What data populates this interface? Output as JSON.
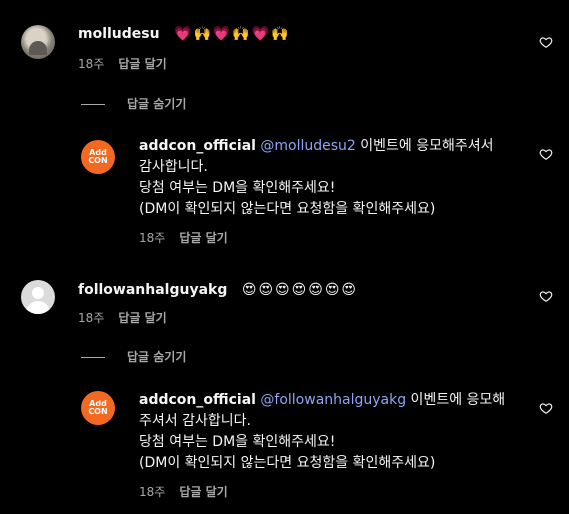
{
  "comments": [
    {
      "username": "molludesu",
      "emojis": "💗🙌💗🙌💗🙌",
      "time": "18주",
      "reply_label": "답글 달기",
      "hide_label": "답글 숨기기",
      "reply": {
        "username": "addcon_official",
        "mention": "@molludesu2",
        "text_line1_rest": " 이벤트에 응모해주셔서",
        "text_line2": "감사합니다.",
        "text_line3": "당첨 여부는 DM을 확인해주세요!",
        "text_line4": "(DM이 확인되지 않는다면 요청함을 확인해주세요)",
        "time": "18주",
        "reply_label": "답글 달기"
      }
    },
    {
      "username": "followanhalguyakg",
      "emojis": "😍😍😍😍😍😍😍",
      "time": "18주",
      "reply_label": "답글 달기",
      "hide_label": "답글 숨기기",
      "reply": {
        "username": "addcon_official",
        "mention": "@followanhalguyakg",
        "text_line1_rest": " 이벤트에 응모해",
        "text_line2": "주셔서 감사합니다.",
        "text_line3": "당첨 여부는 DM을 확인해주세요!",
        "text_line4": "(DM이 확인되지 않는다면 요청함을 확인해주세요)",
        "time": "18주",
        "reply_label": "답글 달기"
      }
    }
  ],
  "brand_logo_text": [
    "Add",
    "CON"
  ],
  "icons": {
    "like": "heart-outline-icon"
  },
  "colors": {
    "background": "#000000",
    "text": "#f5f5f5",
    "muted": "#a8a8a8",
    "mention": "#8da5f5",
    "brand": "#f26a21"
  }
}
